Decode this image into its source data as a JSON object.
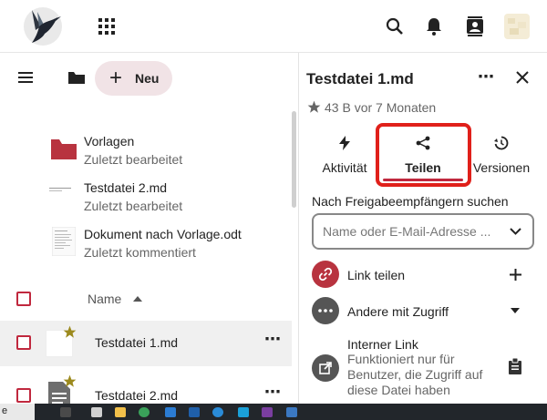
{
  "header": {
    "logo_icon": "hummingbird-logo",
    "apps_icon": "apps-grid-icon",
    "search_icon": "search-icon",
    "notifications_icon": "bell-icon",
    "contacts_icon": "contacts-icon",
    "avatar_icon": "user-avatar"
  },
  "files": {
    "new_button_label": "Neu",
    "templates": [
      {
        "name": "Vorlagen",
        "sub": "Zuletzt bearbeitet",
        "icon": "folder-icon"
      },
      {
        "name": "Testdatei 2.md",
        "sub": "Zuletzt bearbeitet",
        "icon": "text-file-icon"
      },
      {
        "name": "Dokument nach Vorlage.odt",
        "sub": "Zuletzt kommentiert",
        "icon": "document-icon"
      }
    ],
    "sort_column_label": "Name",
    "rows": [
      {
        "name": "Testdatei 1.md",
        "starred": true
      },
      {
        "name": "Testdatei 2.md",
        "starred": true
      }
    ]
  },
  "sidebar": {
    "file_title": "Testdatei 1.md",
    "meta": "43 B vor 7 Monaten",
    "tabs": [
      {
        "label": "Aktivität",
        "icon": "lightning-icon",
        "active": false
      },
      {
        "label": "Teilen",
        "icon": "share-icon",
        "active": true
      },
      {
        "label": "Versionen",
        "icon": "history-icon",
        "active": false
      }
    ],
    "search_label": "Nach Freigabeempfängern suchen",
    "search_placeholder": "Name oder E-Mail-Adresse ...",
    "share_link_label": "Link teilen",
    "others_label": "Andere mit Zugriff",
    "internal_link_title": "Interner Link",
    "internal_link_desc_1": "Funktioniert nur für",
    "internal_link_desc_2": "Benutzer, die Zugriff auf",
    "internal_link_desc_3": "diese Datei haben"
  },
  "taskbar": {
    "partial_label": "e"
  },
  "colors": {
    "accent": "#c0283e",
    "tab_underline": "#c0283e",
    "star": "#9c8a1e",
    "highlight_box": "#e0201a",
    "folder": "#b8333f",
    "link_circle": "#b8333f",
    "neutral_circle": "#555555",
    "new_button_bg": "#f1e3e6"
  }
}
